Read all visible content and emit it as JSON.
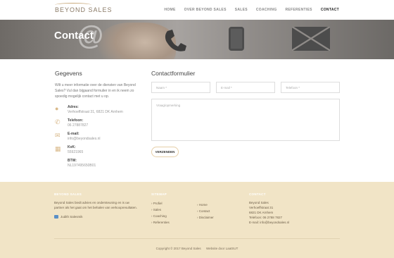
{
  "header": {
    "logo_text": "BEYOND SALES",
    "nav": [
      "HOME",
      "OVER BEYOND SALES",
      "SALES",
      "COACHING",
      "REFERENTIES",
      "CONTACT"
    ],
    "active": "CONTACT"
  },
  "hero": {
    "title": "Contact"
  },
  "gegevens": {
    "title": "Gegevens",
    "intro": "Wilt u meer informatie over de diensten van Beyond Sales? Vul dan bijgaand formulier in en ik neem zo spoedig mogelijk contact met u op.",
    "items": [
      {
        "icon": "map-pin-icon",
        "label": "Adres:",
        "value": "Verhoeffstraat 31, 6821 DK Arnhem"
      },
      {
        "icon": "phone-icon",
        "label": "Telefoon:",
        "value": "06 27887827"
      },
      {
        "icon": "envelope-icon",
        "label": "E-mail:",
        "value": "info@beyondsales.nl"
      },
      {
        "icon": "building-icon",
        "label": "KvK:",
        "value": "55921965"
      },
      {
        "icon": "",
        "label": "BTW:",
        "value": "NL197495650B01"
      }
    ]
  },
  "form": {
    "title": "Contactformulier",
    "name": "Naam *",
    "email": "E-mail *",
    "phone": "Telefoon *",
    "message": "Vraag/opmerking",
    "submit": "VERZENDEN"
  },
  "footer": {
    "col1": {
      "title": "BEYOND SALES",
      "text": "Beyond Sales biedt advies en ondersteuning en is uw partner als het gaat om het behalen van verkoopresultaten.",
      "linkedin": "Judith Salesmik"
    },
    "col2": {
      "title": "SITEMAP",
      "links_a": [
        "Profiel",
        "Sales",
        "Coaching",
        "Referenties"
      ],
      "links_b": [
        "Home",
        "Contact",
        "Disclaimer"
      ]
    },
    "col3": {
      "title": "CONTACT",
      "lines": [
        "Beyond Sales",
        "Verhoeffstraat 31",
        "6821 DK Arnhem",
        "Telefoon: 06 2788 7827",
        "E-mail: info@beyondsales.nl"
      ]
    },
    "copyright": "Copyright © 2017 Beyond Sales",
    "credit": "Website door LaatSUT"
  }
}
